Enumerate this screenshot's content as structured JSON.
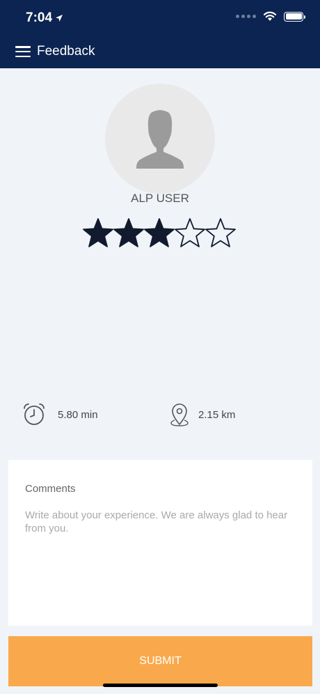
{
  "status_bar": {
    "time": "7:04"
  },
  "header": {
    "title": "Feedback"
  },
  "profile": {
    "name": "ALP USER",
    "rating": 3,
    "max_rating": 5
  },
  "stats": {
    "duration": "5.80 min",
    "distance": "2.15 km"
  },
  "comments": {
    "label": "Comments",
    "placeholder": "Write about your experience. We are always glad to hear from you."
  },
  "submit": {
    "label": "SUBMIT"
  },
  "colors": {
    "header_bg": "#0b2451",
    "star_fill": "#111a2e",
    "submit_bg": "#f9a94b"
  },
  "icons": {
    "menu": "menu-icon",
    "clock": "alarm-clock-icon",
    "location": "location-pin-icon",
    "avatar": "person-silhouette-icon",
    "star": "star-icon"
  }
}
